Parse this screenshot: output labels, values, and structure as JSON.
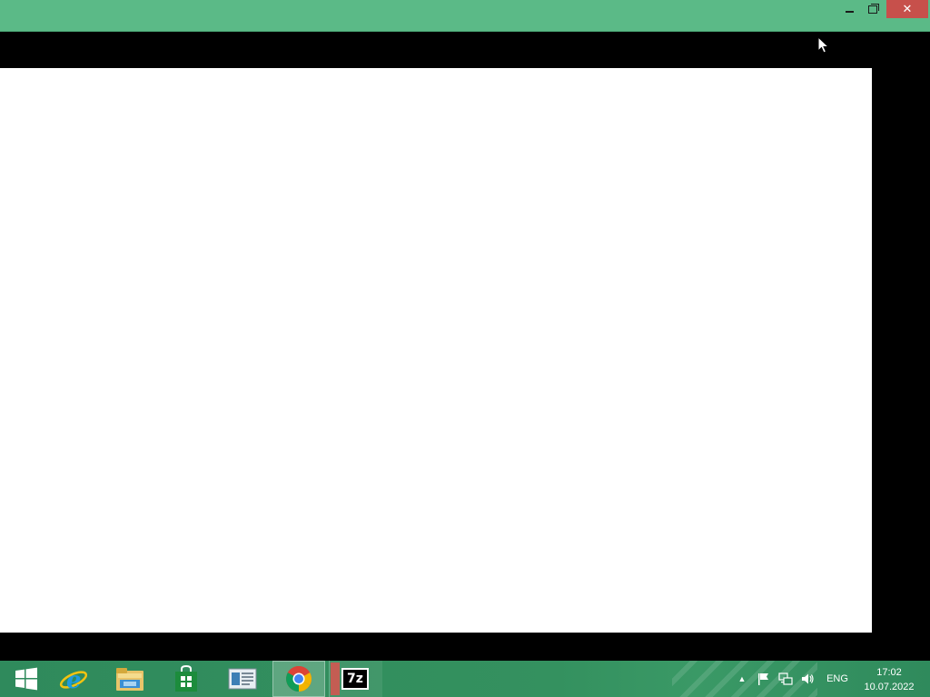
{
  "window": {
    "title": "",
    "minimize_label": "",
    "close_glyph": "✕"
  },
  "taskbar": {
    "items": [
      {
        "name": "start-button",
        "icon": "windows-logo-icon"
      },
      {
        "name": "internet-explorer",
        "icon": "internet-explorer-icon"
      },
      {
        "name": "file-explorer",
        "icon": "folder-icon"
      },
      {
        "name": "store",
        "icon": "store-bag-icon"
      },
      {
        "name": "reader",
        "icon": "document-reader-icon"
      },
      {
        "name": "chrome",
        "icon": "chrome-icon",
        "active": true
      },
      {
        "name": "7zip",
        "icon": "7zip-icon",
        "label": "7z"
      }
    ],
    "tray": {
      "chevron": "▲",
      "language": "ENG",
      "time": "17:02",
      "date": "10.07.2022"
    }
  },
  "colors": {
    "titlebar": "#5bba87",
    "taskbar": "#2f8a5c",
    "close_button": "#c7504b"
  }
}
